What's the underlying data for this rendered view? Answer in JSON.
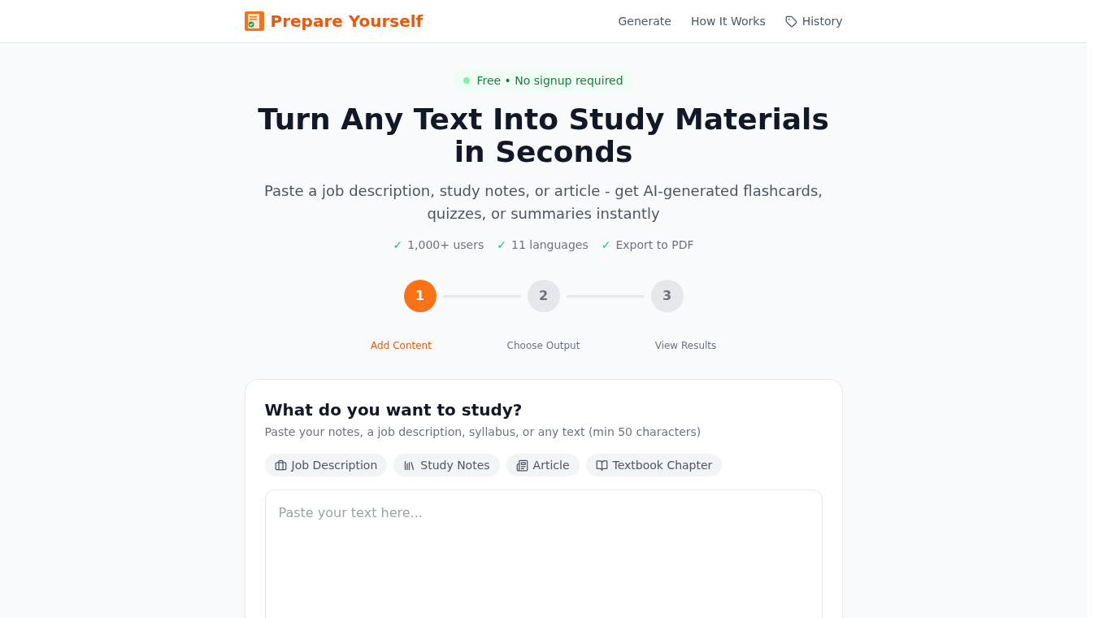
{
  "header": {
    "brand": "Prepare Yourself",
    "nav": [
      {
        "label": "Generate",
        "kind": "text"
      },
      {
        "label": "How It Works",
        "kind": "text"
      },
      {
        "label": "History",
        "kind": "icon"
      }
    ]
  },
  "badge": {
    "text": "Free • No signup required"
  },
  "hero": {
    "title": "Turn Any Text Into Study Materials in Seconds",
    "subtitle": "Paste a job description, study notes, or article - get AI-generated flashcards, quizzes, or summaries instantly"
  },
  "features": [
    {
      "check": "✓",
      "text": "1,000+ users"
    },
    {
      "check": "✓",
      "text": "11 languages"
    },
    {
      "check": "✓",
      "text": "Export to PDF"
    }
  ],
  "steps": [
    {
      "number": "1",
      "label": "Add Content",
      "selected": true
    },
    {
      "number": "2",
      "label": "Choose Output",
      "selected": false
    },
    {
      "number": "3",
      "label": "View Results",
      "selected": false
    }
  ],
  "card": {
    "title": "What do you want to study?",
    "hint": "Paste your notes, a job description, syllabus, or any text (min 50 characters)",
    "chips": [
      {
        "label": "Job Description",
        "kind": "briefcase"
      },
      {
        "label": "Study Notes",
        "kind": "books"
      },
      {
        "label": "Article",
        "kind": "newspaper"
      },
      {
        "label": "Textbook Chapter",
        "kind": "book"
      }
    ],
    "textarea": {
      "placeholder": "Paste your text here..."
    }
  }
}
